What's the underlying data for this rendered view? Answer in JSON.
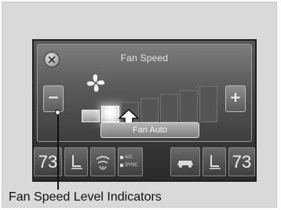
{
  "screen": {
    "title": "Fan Speed",
    "close_symbol": "×",
    "minus_label": "−",
    "plus_label": "+",
    "fan_auto_label": "Fan Auto",
    "fan_levels_total": 7,
    "fan_level_current": 2
  },
  "bottom_bar": {
    "driver_temp": "73",
    "passenger_temp": "73",
    "ac_label": "A/C",
    "sync_label": "SYNC"
  },
  "caption": {
    "text": "Fan Speed Level Indicators"
  },
  "colors": {
    "background": "#d9d9d9",
    "screen": "#3a3a3a",
    "indicator_on": "#d8d8d8",
    "indicator_off": "#555555"
  },
  "icons": [
    "close-icon",
    "fan-icon",
    "seat-heater-icon",
    "defrost-icon",
    "recirculation-icon",
    "arrow-up-icon"
  ]
}
